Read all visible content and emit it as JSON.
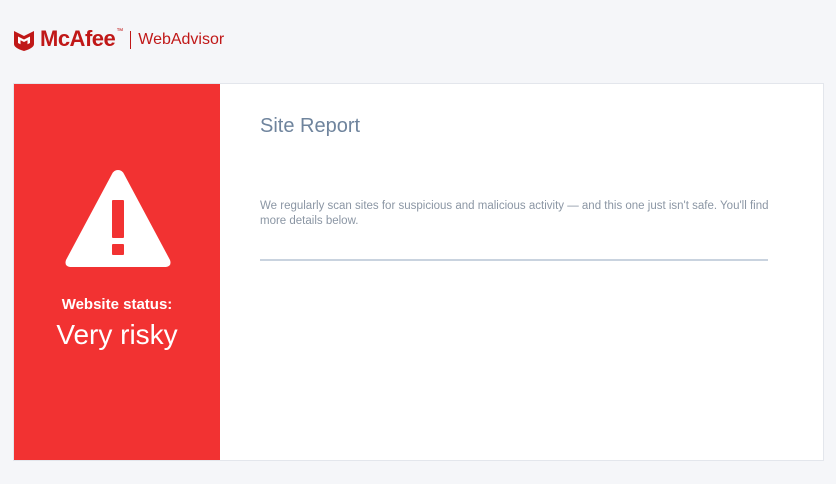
{
  "header": {
    "brand": "McAfee",
    "brand_tm": "™",
    "product": "WebAdvisor",
    "logo_icon": "mcafee-shield-icon"
  },
  "status": {
    "icon": "warning-triangle-icon",
    "label": "Website status:",
    "value": "Very risky",
    "color": "#f23232"
  },
  "report": {
    "title": "Site Report",
    "description": "We regularly scan sites for suspicious and malicious activity — and this one just isn't safe. You'll find more details below."
  },
  "colors": {
    "brand_red": "#c01818",
    "title": "#6f849d",
    "text": "#8b96a4",
    "divider": "#c9d3df",
    "background": "#f5f6f9"
  }
}
